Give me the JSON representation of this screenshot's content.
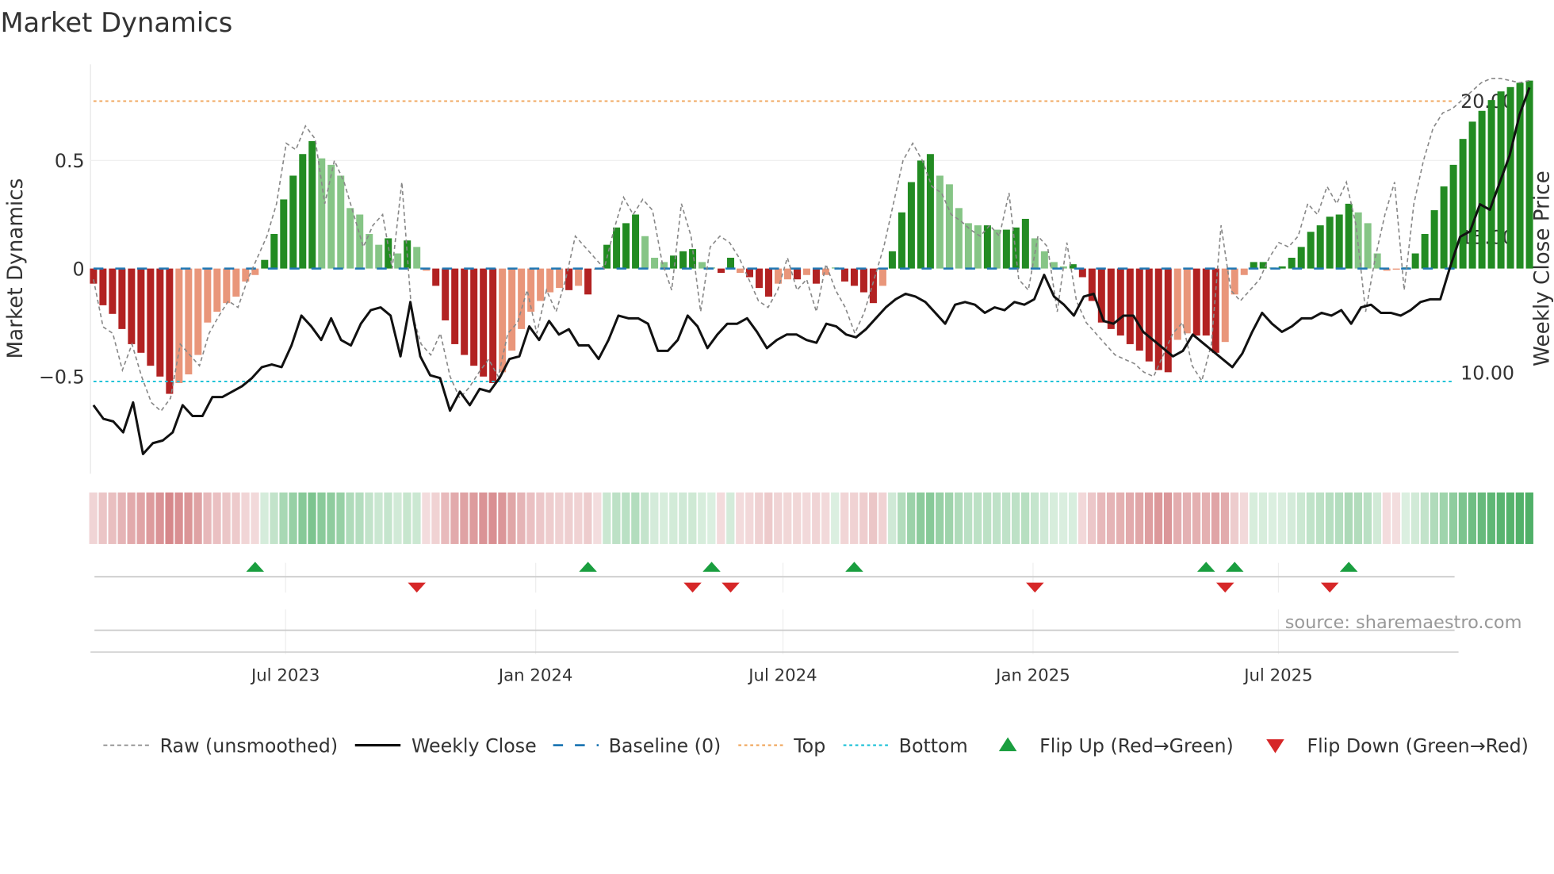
{
  "chart_data": {
    "type": "bar",
    "title": "Market Dynamics",
    "ylabel": "Market Dynamics",
    "y2label": "Weekly Close Price",
    "ylim": [
      -0.97,
      0.95
    ],
    "y2lim": [
      6.2,
      21.7
    ],
    "frequency": "weekly",
    "yticks": [
      {
        "v": 0.5,
        "label": "0.5"
      },
      {
        "v": 0,
        "label": "0"
      },
      {
        "v": -0.5,
        "label": "−0.5"
      }
    ],
    "y2ticks": [
      {
        "v": 20,
        "label": "20.00"
      },
      {
        "v": 15,
        "label": "15.00"
      },
      {
        "v": 10,
        "label": "10.00"
      }
    ],
    "xticks": [
      {
        "week": 20.2,
        "label": "Jul 2023"
      },
      {
        "week": 46.5,
        "label": "Jan 2024"
      },
      {
        "week": 72.5,
        "label": "Jul 2024"
      },
      {
        "week": 98.8,
        "label": "Jan 2025"
      },
      {
        "week": 124.6,
        "label": "Jul 2025"
      }
    ],
    "top_level": 0.775,
    "bottom_level": -0.523,
    "baseline": 0,
    "values": [
      -0.07,
      -0.17,
      -0.21,
      -0.28,
      -0.35,
      -0.39,
      -0.45,
      -0.5,
      -0.58,
      -0.53,
      -0.49,
      -0.4,
      -0.25,
      -0.2,
      -0.16,
      -0.13,
      -0.06,
      -0.03,
      0.04,
      0.16,
      0.32,
      0.43,
      0.53,
      0.59,
      0.51,
      0.48,
      0.43,
      0.28,
      0.25,
      0.16,
      0.11,
      0.14,
      0.07,
      0.13,
      0.1,
      -0.01,
      -0.08,
      -0.24,
      -0.35,
      -0.4,
      -0.45,
      -0.5,
      -0.53,
      -0.48,
      -0.38,
      -0.28,
      -0.2,
      -0.15,
      -0.11,
      -0.09,
      -0.1,
      -0.08,
      -0.12,
      -0.005,
      0.11,
      0.19,
      0.21,
      0.25,
      0.15,
      0.05,
      0.03,
      0.06,
      0.08,
      0.09,
      0.03,
      0.005,
      -0.02,
      0.05,
      -0.02,
      -0.04,
      -0.09,
      -0.13,
      -0.07,
      -0.05,
      -0.05,
      -0.03,
      -0.07,
      -0.03,
      0.005,
      -0.06,
      -0.08,
      -0.11,
      -0.16,
      -0.08,
      0.08,
      0.26,
      0.4,
      0.5,
      0.53,
      0.43,
      0.39,
      0.28,
      0.21,
      0.2,
      0.2,
      0.18,
      0.18,
      0.19,
      0.23,
      0.14,
      0.08,
      0.03,
      0.01,
      0.02,
      -0.04,
      -0.15,
      -0.25,
      -0.28,
      -0.31,
      -0.35,
      -0.38,
      -0.43,
      -0.47,
      -0.48,
      -0.33,
      -0.3,
      -0.31,
      -0.31,
      -0.39,
      -0.34,
      -0.12,
      -0.03,
      0.03,
      0.03,
      0.005,
      0.01,
      0.05,
      0.1,
      0.17,
      0.2,
      0.24,
      0.25,
      0.3,
      0.26,
      0.21,
      0.07,
      -0.01,
      -0.005,
      0.005,
      0.07,
      0.16,
      0.27,
      0.38,
      0.48,
      0.6,
      0.68,
      0.73,
      0.78,
      0.82,
      0.84,
      0.86,
      0.87
    ],
    "raw": [
      -0.05,
      -0.27,
      -0.3,
      -0.47,
      -0.35,
      -0.5,
      -0.62,
      -0.66,
      -0.6,
      -0.35,
      -0.4,
      -0.45,
      -0.3,
      -0.22,
      -0.15,
      -0.18,
      -0.05,
      0.05,
      0.15,
      0.3,
      0.58,
      0.55,
      0.66,
      0.6,
      0.3,
      0.5,
      0.4,
      0.25,
      0.1,
      0.2,
      0.25,
      0.0,
      0.4,
      -0.2,
      -0.35,
      -0.4,
      -0.3,
      -0.5,
      -0.6,
      -0.55,
      -0.48,
      -0.42,
      -0.5,
      -0.3,
      -0.25,
      -0.1,
      -0.3,
      -0.1,
      -0.2,
      -0.05,
      0.15,
      0.1,
      0.05,
      0.0,
      0.18,
      0.33,
      0.25,
      0.32,
      0.27,
      0.03,
      -0.1,
      0.3,
      0.15,
      -0.2,
      0.1,
      0.15,
      0.12,
      0.05,
      -0.05,
      -0.15,
      -0.18,
      -0.1,
      0.05,
      -0.1,
      -0.05,
      -0.2,
      0.02,
      -0.1,
      -0.18,
      -0.3,
      -0.2,
      -0.05,
      0.1,
      0.3,
      0.5,
      0.58,
      0.5,
      0.38,
      0.35,
      0.25,
      0.22,
      0.18,
      0.15,
      0.2,
      0.15,
      0.35,
      -0.05,
      -0.1,
      0.15,
      0.1,
      -0.2,
      0.12,
      -0.15,
      -0.25,
      -0.3,
      -0.35,
      -0.4,
      -0.42,
      -0.44,
      -0.48,
      -0.5,
      -0.4,
      -0.3,
      -0.25,
      -0.45,
      -0.52,
      -0.35,
      0.2,
      -0.1,
      -0.15,
      -0.1,
      -0.05,
      0.05,
      0.12,
      0.1,
      0.15,
      0.3,
      0.25,
      0.38,
      0.3,
      0.4,
      0.2,
      -0.2,
      0.05,
      0.25,
      0.4,
      -0.1,
      0.3,
      0.5,
      0.65,
      0.72,
      0.74,
      0.78,
      0.82,
      0.86,
      0.88,
      0.88,
      0.87,
      0.86,
      0.87
    ],
    "close": [
      8.8,
      8.3,
      8.2,
      7.8,
      8.9,
      7.0,
      7.4,
      7.5,
      7.8,
      8.8,
      8.4,
      8.4,
      9.1,
      9.1,
      9.3,
      9.5,
      9.8,
      10.2,
      10.3,
      10.2,
      11.0,
      12.1,
      11.7,
      11.2,
      12.0,
      11.2,
      11.0,
      11.8,
      12.3,
      12.4,
      12.1,
      10.6,
      12.6,
      10.6,
      9.9,
      9.8,
      8.6,
      9.3,
      8.8,
      9.4,
      9.3,
      9.8,
      10.5,
      10.6,
      11.7,
      11.2,
      11.9,
      11.4,
      11.6,
      11.0,
      11.0,
      10.5,
      11.2,
      12.1,
      12.0,
      12.0,
      11.8,
      10.8,
      10.8,
      11.2,
      12.1,
      11.7,
      10.9,
      11.4,
      11.8,
      11.8,
      12.0,
      11.5,
      10.9,
      11.2,
      11.4,
      11.4,
      11.2,
      11.1,
      11.8,
      11.7,
      11.4,
      11.3,
      11.6,
      12.0,
      12.4,
      12.7,
      12.9,
      12.8,
      12.6,
      12.2,
      11.8,
      12.5,
      12.6,
      12.5,
      12.2,
      12.4,
      12.3,
      12.6,
      12.5,
      12.7,
      13.6,
      12.8,
      12.5,
      12.1,
      12.8,
      12.9,
      11.9,
      11.8,
      12.1,
      12.1,
      11.5,
      11.2,
      10.9,
      10.6,
      10.8,
      11.4,
      11.1,
      10.8,
      10.5,
      10.2,
      10.7,
      11.5,
      12.2,
      11.8,
      11.5,
      11.7,
      12.0,
      12.0,
      12.2,
      12.1,
      12.3,
      11.8,
      12.4,
      12.5,
      12.2,
      12.2,
      12.1,
      12.3,
      12.6,
      12.7,
      12.7,
      13.9,
      15.0,
      15.2,
      16.2,
      16.0,
      17.0,
      18.0,
      19.5,
      20.5
    ],
    "flip_up_weeks": [
      17,
      52,
      65,
      80,
      117,
      120,
      132
    ],
    "flip_down_weeks": [
      34,
      63,
      67,
      99,
      119,
      130
    ],
    "colors": {
      "up_strong": "#228b22",
      "up_weak": "#86c586",
      "down_strong": "#b22222",
      "down_weak": "#e9967a",
      "close": "#111111",
      "raw": "#888888",
      "baseline": "#1f77b4",
      "top": "#f0a860",
      "bottom": "#22c3d8",
      "flip_up": "#1a9e3f",
      "flip_down": "#d62728"
    },
    "legend": [
      {
        "key": "raw",
        "label": "Raw (unsmoothed)"
      },
      {
        "key": "close",
        "label": "Weekly Close"
      },
      {
        "key": "baseline",
        "label": "Baseline (0)"
      },
      {
        "key": "top",
        "label": "Top"
      },
      {
        "key": "bottom",
        "label": "Bottom"
      },
      {
        "key": "flip_up",
        "label": "Flip Up (Red→Green)"
      },
      {
        "key": "flip_down",
        "label": "Flip Down (Green→Red)"
      }
    ],
    "legend_position": "bottom",
    "source": "source: sharemaestro.com"
  }
}
